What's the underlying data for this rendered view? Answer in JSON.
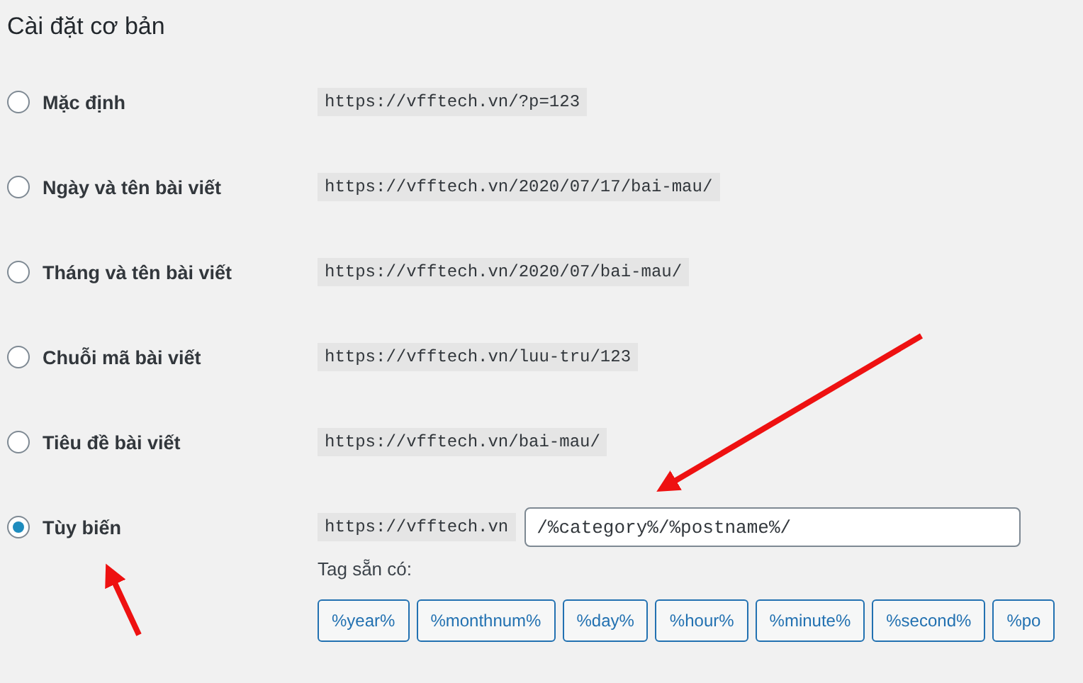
{
  "heading": "Cài đặt cơ bản",
  "options": [
    {
      "label": "Mặc định",
      "example": "https://vfftech.vn/?p=123",
      "selected": false
    },
    {
      "label": "Ngày và tên bài viết",
      "example": "https://vfftech.vn/2020/07/17/bai-mau/",
      "selected": false
    },
    {
      "label": "Tháng và tên bài viết",
      "example": "https://vfftech.vn/2020/07/bai-mau/",
      "selected": false
    },
    {
      "label": "Chuỗi mã bài viết",
      "example": "https://vfftech.vn/luu-tru/123",
      "selected": false
    },
    {
      "label": "Tiêu đề bài viết",
      "example": "https://vfftech.vn/bai-mau/",
      "selected": false
    },
    {
      "label": "Tùy biến",
      "example": "https://vfftech.vn",
      "selected": true,
      "value": "/%category%/%postname%/"
    }
  ],
  "tags_label": "Tag sẵn có:",
  "tags": [
    "%year%",
    "%monthnum%",
    "%day%",
    "%hour%",
    "%minute%",
    "%second%",
    "%po"
  ]
}
